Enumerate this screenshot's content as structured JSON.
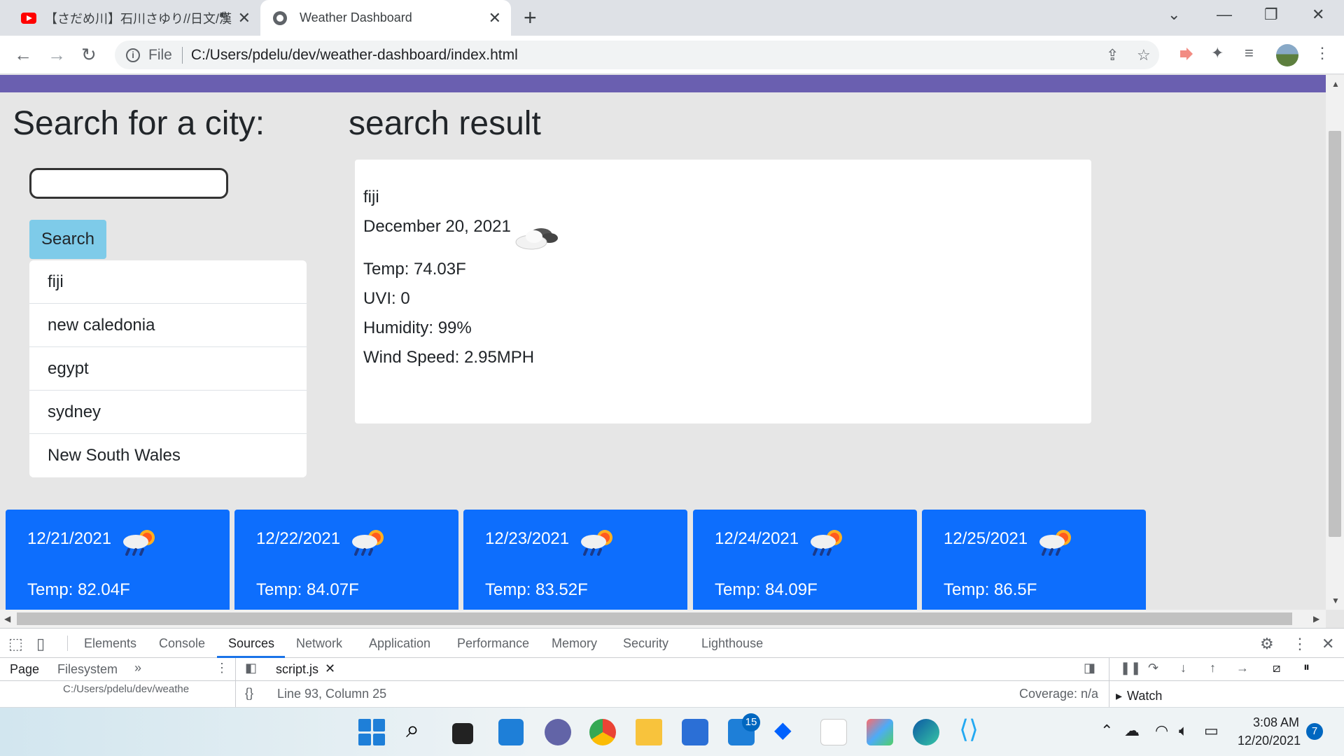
{
  "browser": {
    "tabs": [
      {
        "title": "【さだめ川】石川さゆり//日文/漢",
        "active": false
      },
      {
        "title": "Weather Dashboard",
        "active": true
      }
    ],
    "address": {
      "scheme_label": "File",
      "url": "C:/Users/pdelu/dev/weather-dashboard/index.html"
    }
  },
  "page": {
    "search_heading": "Search for a city:",
    "result_heading": "search result",
    "search_input": {
      "value": "",
      "placeholder": ""
    },
    "search_button": "Search",
    "history": [
      "fiji",
      "new caledonia",
      "egypt",
      "sydney",
      "New South Wales"
    ],
    "current": {
      "city": "fiji",
      "date": "December 20, 2021",
      "icon": "cloudy-icon",
      "temp": "Temp: 74.03F",
      "uvi": "UVI: 0",
      "humidity": "Humidity: 99%",
      "wind": "Wind Speed: 2.95MPH"
    },
    "forecast": [
      {
        "date": "12/21/2021",
        "icon": "rain-sun-icon",
        "temp": "Temp: 82.04F"
      },
      {
        "date": "12/22/2021",
        "icon": "rain-sun-icon",
        "temp": "Temp: 84.07F"
      },
      {
        "date": "12/23/2021",
        "icon": "rain-sun-icon",
        "temp": "Temp: 83.52F"
      },
      {
        "date": "12/24/2021",
        "icon": "rain-sun-icon",
        "temp": "Temp: 84.09F"
      },
      {
        "date": "12/25/2021",
        "icon": "rain-sun-icon",
        "temp": "Temp: 86.5F"
      }
    ],
    "colors": {
      "header": "#6a5fb0",
      "search_button": "#7ecbe9",
      "forecast_card": "#0d6efd"
    }
  },
  "devtools": {
    "tabs": [
      "Elements",
      "Console",
      "Sources",
      "Network",
      "Application",
      "Performance",
      "Memory",
      "Security",
      "Lighthouse"
    ],
    "active_tab": "Sources",
    "navigator_tabs": [
      "Page",
      "Filesystem"
    ],
    "navigator_path": "C:/Users/pdelu/dev/weathe",
    "open_file": "script.js",
    "cursor_position": "Line 93, Column 25",
    "coverage": "Coverage: n/a",
    "watch_label": "Watch"
  },
  "taskbar": {
    "mail_badge": "15",
    "notification_count": "7",
    "time": "3:08 AM",
    "date": "12/20/2021"
  }
}
